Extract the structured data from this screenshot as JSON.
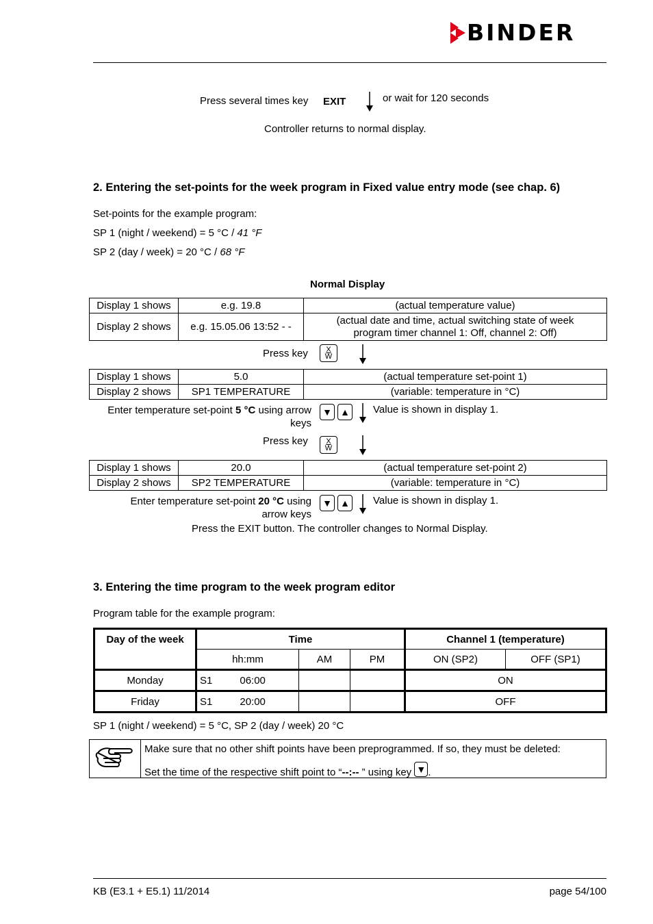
{
  "header": {
    "brand": "BINDER",
    "brand_color": "#e3001b"
  },
  "exit_step": {
    "instruction": "Press several times key",
    "key": "EXIT",
    "alternative": "or wait for 120 seconds",
    "result": "Controller returns to normal display."
  },
  "section2": {
    "heading": "2. Entering the set-points for the week program in Fixed value entry mode (see chap. 6)",
    "intro": "Set-points for the example program:",
    "sp1_prefix": "SP 1 (night / weekend) = 5 °C / ",
    "sp1_f": "41 °F",
    "sp2_prefix": "SP 2 (day / week) = 20 °C / ",
    "sp2_f": "68 °F",
    "normal_display_title": "Normal Display",
    "table_normal": [
      [
        "Display 1 shows",
        "e.g. 19.8",
        "(actual temperature value)"
      ],
      [
        "Display 2 shows",
        "e.g. 15.05.06  13:52 - -",
        "(actual date and time, actual switching state of week program timer channel 1: Off, channel 2: Off)"
      ]
    ],
    "press_key_label": "Press key",
    "key_top": "X",
    "key_bottom": "W",
    "table_sp1": [
      [
        "Display 1 shows",
        "5.0",
        "(actual temperature set-point 1)"
      ],
      [
        "Display 2 shows",
        "SP1 TEMPERATURE",
        "(variable: temperature in °C)"
      ]
    ],
    "enter_sp1_pre": "Enter temperature set-point ",
    "enter_sp1_bold": "5 °C",
    "enter_sp1_post": " using arrow keys",
    "value_shown": "Value is shown in display 1.",
    "table_sp2": [
      [
        "Display 1 shows",
        "20.0",
        "(actual temperature set-point 2)"
      ],
      [
        "Display 2 shows",
        "SP2 TEMPERATURE",
        "(variable: temperature in °C)"
      ]
    ],
    "enter_sp2_pre": "Enter temperature set-point ",
    "enter_sp2_bold": "20 °C",
    "enter_sp2_post": " using arrow keys",
    "exit_note": "Press the EXIT button. The controller changes to Normal Display.",
    "down_arrow_icon": "▼",
    "up_arrow_icon": "▲"
  },
  "section3": {
    "heading": "3. Entering the time program to the week program editor",
    "intro": "Program table for the example program:",
    "table": {
      "headers": {
        "day": "Day of the week",
        "time": "Time",
        "channel": "Channel 1 (temperature)"
      },
      "subheaders": [
        "hh:mm",
        "AM",
        "PM",
        "ON (SP2)",
        "OFF (SP1)"
      ],
      "rows": [
        {
          "day": "Monday",
          "shift": "S1",
          "time": "06:00",
          "am": "",
          "pm": "",
          "channel": "ON"
        },
        {
          "day": "Friday",
          "shift": "S1",
          "time": "20:00",
          "am": "",
          "pm": "",
          "channel": "OFF"
        }
      ]
    },
    "footnote": "SP 1 (night / weekend) = 5 °C, SP 2 (day / week) 20 °C",
    "note_line1": "Make sure that no other shift points have been preprogrammed. If so, they must be deleted:",
    "note_line2_pre": "Set the time of the respective shift point to “ ",
    "note_line2_bold": "--:--",
    "note_line2_post": " ” using key ",
    "note_line2_end": "."
  },
  "footer": {
    "left": "KB (E3.1 + E5.1) 11/2014",
    "right": "page 54/100"
  }
}
